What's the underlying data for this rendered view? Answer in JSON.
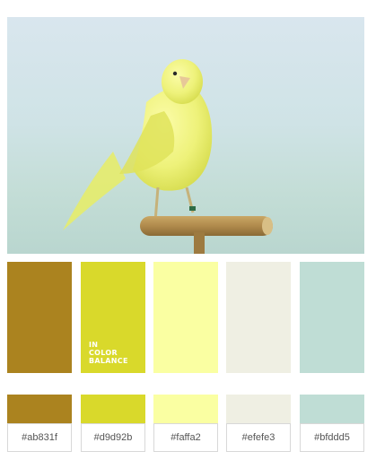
{
  "photo": {
    "subject_icon": "canary-on-perch-icon",
    "colors": {
      "sky": "#d3e4ea",
      "bird": "#eef27a",
      "bird_shadow": "#d6dc4e",
      "perch": "#b08a4c"
    }
  },
  "brand": {
    "line1": "IN",
    "line2": "COLOR",
    "line3": "BALANCE"
  },
  "palette": [
    {
      "color": "#ab831f",
      "hex": "#ab831f"
    },
    {
      "color": "#d9d92b",
      "hex": "#d9d92b"
    },
    {
      "color": "#faffa2",
      "hex": "#faffa2"
    },
    {
      "color": "#efefe3",
      "hex": "#efefe3"
    },
    {
      "color": "#bfddd5",
      "hex": "#bfddd5"
    }
  ]
}
